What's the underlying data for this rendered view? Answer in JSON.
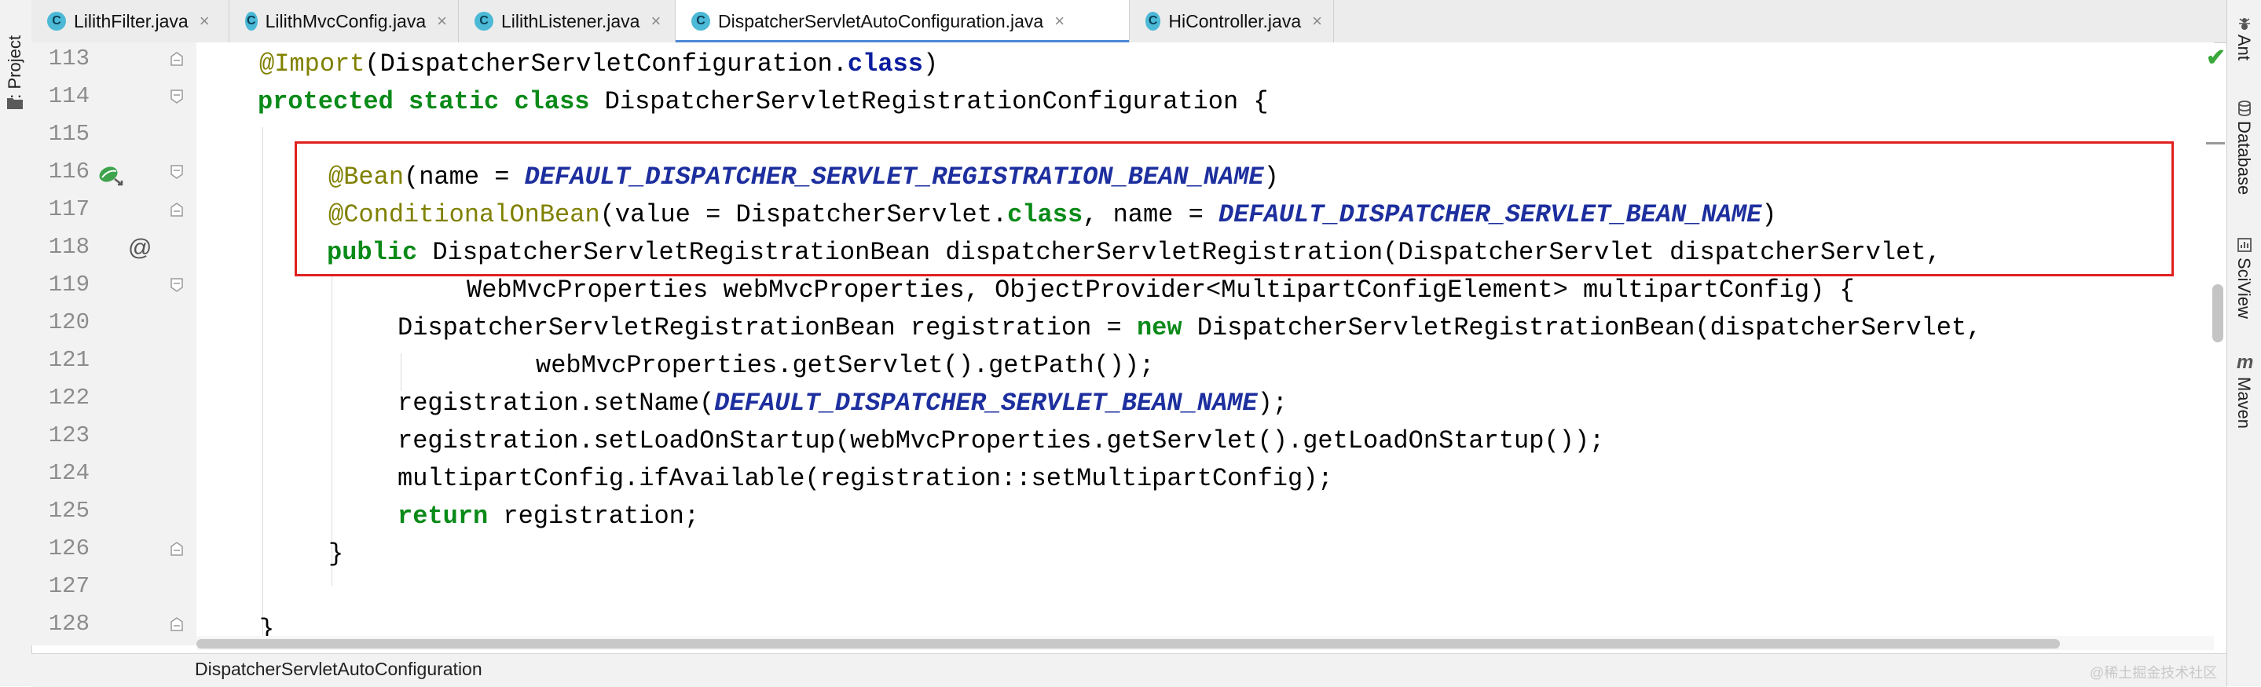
{
  "left_strip": {
    "label": "1: Project"
  },
  "tabs": [
    {
      "label": "LilithFilter.java",
      "icon_letter": "C",
      "active": false
    },
    {
      "label": "LilithMvcConfig.java",
      "icon_letter": "C",
      "active": false
    },
    {
      "label": "LilithListener.java",
      "icon_letter": "C",
      "active": false
    },
    {
      "label": "DispatcherServletAutoConfiguration.java",
      "icon_letter": "C",
      "active": true
    },
    {
      "label": "HiController.java",
      "icon_letter": "C",
      "active": false
    }
  ],
  "close_glyph": "×",
  "line_numbers": [
    "113",
    "114",
    "115",
    "116",
    "117",
    "118",
    "119",
    "120",
    "121",
    "122",
    "123",
    "124",
    "125",
    "126",
    "127",
    "128"
  ],
  "gutter_icons": {
    "at_symbol": "@",
    "bean": "bean-icon"
  },
  "code": {
    "l113": {
      "ann": "@Import",
      "rest_a": "(DispatcherServletConfiguration.",
      "kw": "class",
      "rest_b": ")"
    },
    "l114": {
      "kw1": "protected",
      "kw2": "static",
      "kw3": "class",
      "rest": " DispatcherServletRegistrationConfiguration {"
    },
    "l116": {
      "ann": "@Bean",
      "rest_a": "(name = ",
      "const": "DEFAULT_DISPATCHER_SERVLET_REGISTRATION_BEAN_NAME",
      "rest_b": ")"
    },
    "l117": {
      "ann": "@ConditionalOnBean",
      "rest_a": "(value = DispatcherServlet.",
      "kw": "class",
      "rest_b": ", name = ",
      "const": "DEFAULT_DISPATCHER_SERVLET_BEAN_NAME",
      "rest_c": ")"
    },
    "l118": {
      "kw": "public",
      "rest": " DispatcherServletRegistrationBean dispatcherServletRegistration(DispatcherServlet dispatcherServlet,"
    },
    "l119": {
      "text": "WebMvcProperties webMvcProperties, ObjectProvider<MultipartConfigElement> multipartConfig) {"
    },
    "l120": {
      "rest_a": "DispatcherServletRegistrationBean registration = ",
      "kw": "new",
      "rest_b": " DispatcherServletRegistrationBean(dispatcherServlet,"
    },
    "l121": {
      "text": "webMvcProperties.getServlet().getPath());"
    },
    "l122": {
      "rest_a": "registration.setName(",
      "const": "DEFAULT_DISPATCHER_SERVLET_BEAN_NAME",
      "rest_b": ");"
    },
    "l123": {
      "text": "registration.setLoadOnStartup(webMvcProperties.getServlet().getLoadOnStartup());"
    },
    "l124": {
      "text": "multipartConfig.ifAvailable(registration::setMultipartConfig);"
    },
    "l125": {
      "kw": "return",
      "rest": " registration;"
    },
    "l126": {
      "text": "}"
    },
    "l128": {
      "text": "}"
    }
  },
  "right_strip": [
    "Ant",
    "Database",
    "SciView",
    "Maven"
  ],
  "breadcrumb": "DispatcherServletAutoConfiguration",
  "watermark": "@稀土掘金技术社区",
  "colors": {
    "keyword": "#0b1d9e",
    "keyword_green": "#0a8a18",
    "annotation": "#b200b2",
    "constant": "#1d2f9e",
    "highlight_box": "#e0201f",
    "active_tab_underline": "#4a88d4"
  }
}
